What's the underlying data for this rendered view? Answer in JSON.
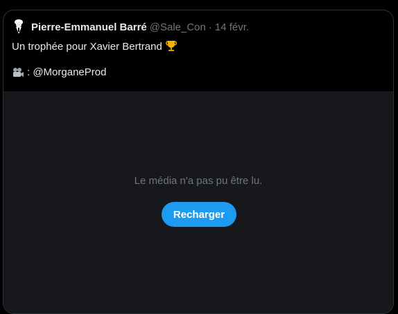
{
  "tweet": {
    "author_name": "Pierre-Emmanuel Barré",
    "handle": "@Sale_Con",
    "separator": "·",
    "date": "14 févr.",
    "text": "Un trophée pour Xavier Bertrand",
    "text_emoji": "trophy-icon",
    "credit_icon": "movie-camera-icon",
    "credit": ": @MorganeProd"
  },
  "media": {
    "error_message": "Le média n'a pas pu être lu.",
    "reload_label": "Recharger"
  },
  "colors": {
    "background": "#000000",
    "media_background": "#16181c",
    "text_primary": "#e7e9ea",
    "text_secondary": "#71767b",
    "accent": "#1d9bf0",
    "border": "#2f3336"
  }
}
